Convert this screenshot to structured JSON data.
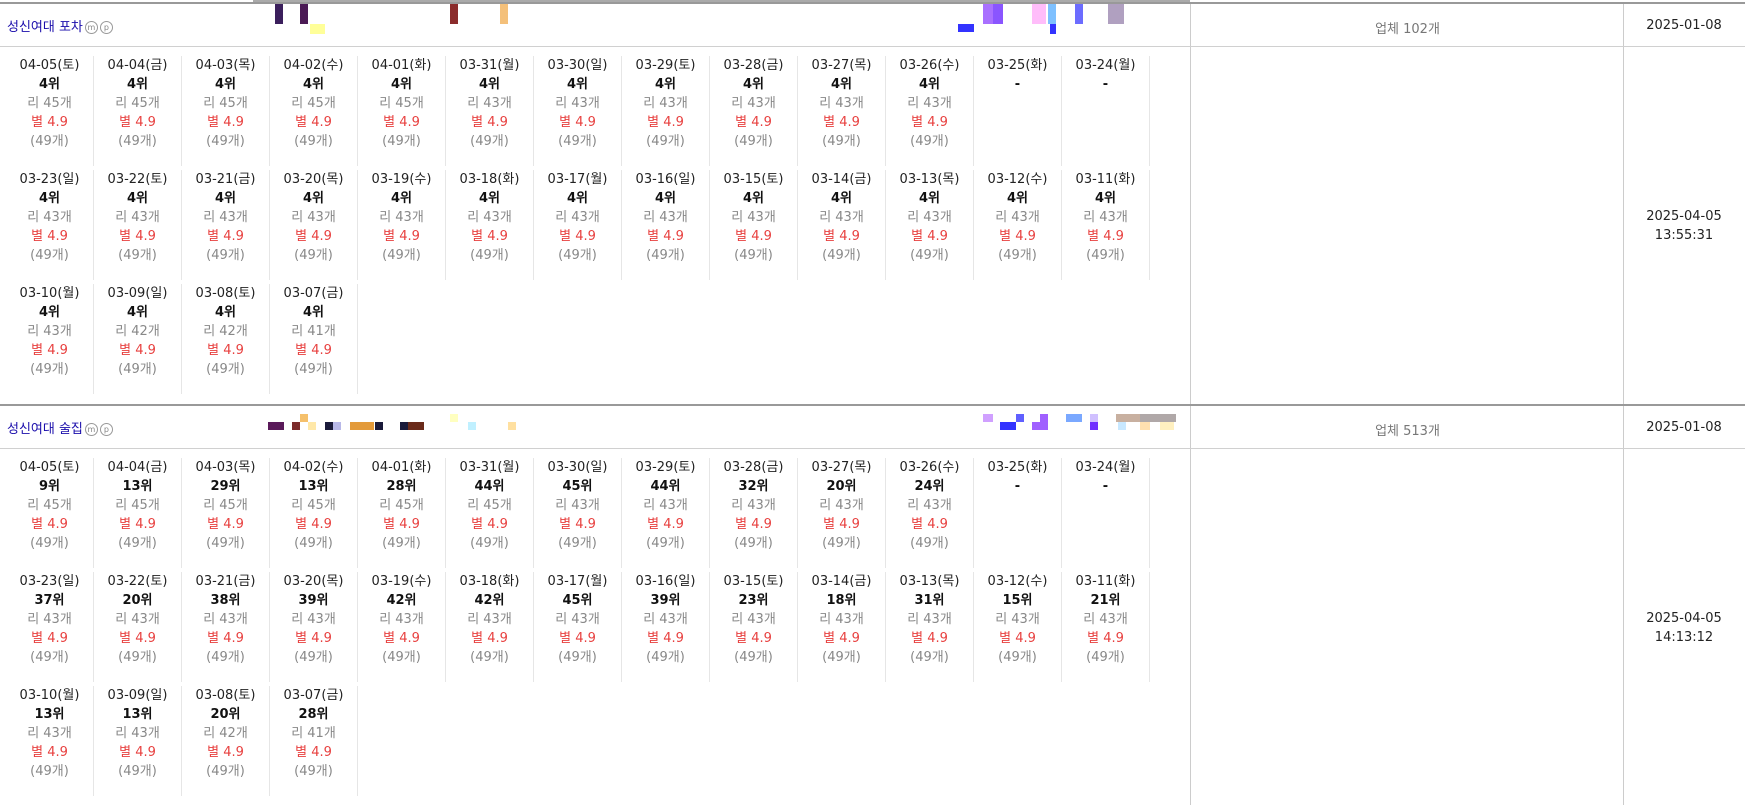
{
  "sections": [
    {
      "title": "성신여대 포차",
      "icons": [
        "m-circle-icon",
        "p-circle-icon"
      ],
      "icon_glyphs": [
        "m",
        "p"
      ],
      "count_label": "업체 102개",
      "start_date": "2025-01-08",
      "updated_date": "2025-04-05",
      "updated_time": "13:55:31",
      "rows": [
        [
          {
            "date": "04-05(토)",
            "rank": "4위",
            "reviews": "리 45개",
            "stars": "별 4.9",
            "count": "(49개)"
          },
          {
            "date": "04-04(금)",
            "rank": "4위",
            "reviews": "리 45개",
            "stars": "별 4.9",
            "count": "(49개)"
          },
          {
            "date": "04-03(목)",
            "rank": "4위",
            "reviews": "리 45개",
            "stars": "별 4.9",
            "count": "(49개)"
          },
          {
            "date": "04-02(수)",
            "rank": "4위",
            "reviews": "리 45개",
            "stars": "별 4.9",
            "count": "(49개)"
          },
          {
            "date": "04-01(화)",
            "rank": "4위",
            "reviews": "리 45개",
            "stars": "별 4.9",
            "count": "(49개)"
          },
          {
            "date": "03-31(월)",
            "rank": "4위",
            "reviews": "리 43개",
            "stars": "별 4.9",
            "count": "(49개)"
          },
          {
            "date": "03-30(일)",
            "rank": "4위",
            "reviews": "리 43개",
            "stars": "별 4.9",
            "count": "(49개)"
          },
          {
            "date": "03-29(토)",
            "rank": "4위",
            "reviews": "리 43개",
            "stars": "별 4.9",
            "count": "(49개)"
          },
          {
            "date": "03-28(금)",
            "rank": "4위",
            "reviews": "리 43개",
            "stars": "별 4.9",
            "count": "(49개)"
          },
          {
            "date": "03-27(목)",
            "rank": "4위",
            "reviews": "리 43개",
            "stars": "별 4.9",
            "count": "(49개)"
          },
          {
            "date": "03-26(수)",
            "rank": "4위",
            "reviews": "리 43개",
            "stars": "별 4.9",
            "count": "(49개)"
          },
          {
            "date": "03-25(화)",
            "rank": "-",
            "reviews": "",
            "stars": "",
            "count": ""
          },
          {
            "date": "03-24(월)",
            "rank": "-",
            "reviews": "",
            "stars": "",
            "count": ""
          }
        ],
        [
          {
            "date": "03-23(일)",
            "rank": "4위",
            "reviews": "리 43개",
            "stars": "별 4.9",
            "count": "(49개)"
          },
          {
            "date": "03-22(토)",
            "rank": "4위",
            "reviews": "리 43개",
            "stars": "별 4.9",
            "count": "(49개)"
          },
          {
            "date": "03-21(금)",
            "rank": "4위",
            "reviews": "리 43개",
            "stars": "별 4.9",
            "count": "(49개)"
          },
          {
            "date": "03-20(목)",
            "rank": "4위",
            "reviews": "리 43개",
            "stars": "별 4.9",
            "count": "(49개)"
          },
          {
            "date": "03-19(수)",
            "rank": "4위",
            "reviews": "리 43개",
            "stars": "별 4.9",
            "count": "(49개)"
          },
          {
            "date": "03-18(화)",
            "rank": "4위",
            "reviews": "리 43개",
            "stars": "별 4.9",
            "count": "(49개)"
          },
          {
            "date": "03-17(월)",
            "rank": "4위",
            "reviews": "리 43개",
            "stars": "별 4.9",
            "count": "(49개)"
          },
          {
            "date": "03-16(일)",
            "rank": "4위",
            "reviews": "리 43개",
            "stars": "별 4.9",
            "count": "(49개)"
          },
          {
            "date": "03-15(토)",
            "rank": "4위",
            "reviews": "리 43개",
            "stars": "별 4.9",
            "count": "(49개)"
          },
          {
            "date": "03-14(금)",
            "rank": "4위",
            "reviews": "리 43개",
            "stars": "별 4.9",
            "count": "(49개)"
          },
          {
            "date": "03-13(목)",
            "rank": "4위",
            "reviews": "리 43개",
            "stars": "별 4.9",
            "count": "(49개)"
          },
          {
            "date": "03-12(수)",
            "rank": "4위",
            "reviews": "리 43개",
            "stars": "별 4.9",
            "count": "(49개)"
          },
          {
            "date": "03-11(화)",
            "rank": "4위",
            "reviews": "리 43개",
            "stars": "별 4.9",
            "count": "(49개)"
          }
        ],
        [
          {
            "date": "03-10(월)",
            "rank": "4위",
            "reviews": "리 43개",
            "stars": "별 4.9",
            "count": "(49개)"
          },
          {
            "date": "03-09(일)",
            "rank": "4위",
            "reviews": "리 42개",
            "stars": "별 4.9",
            "count": "(49개)"
          },
          {
            "date": "03-08(토)",
            "rank": "4위",
            "reviews": "리 42개",
            "stars": "별 4.9",
            "count": "(49개)"
          },
          {
            "date": "03-07(금)",
            "rank": "4위",
            "reviews": "리 41개",
            "stars": "별 4.9",
            "count": "(49개)"
          }
        ]
      ]
    },
    {
      "title": "성신여대 술집",
      "icons": [
        "m-circle-icon",
        "p-circle-icon"
      ],
      "icon_glyphs": [
        "m",
        "p"
      ],
      "count_label": "업체 513개",
      "start_date": "2025-01-08",
      "updated_date": "2025-04-05",
      "updated_time": "14:13:12",
      "rows": [
        [
          {
            "date": "04-05(토)",
            "rank": "9위",
            "reviews": "리 45개",
            "stars": "별 4.9",
            "count": "(49개)"
          },
          {
            "date": "04-04(금)",
            "rank": "13위",
            "reviews": "리 45개",
            "stars": "별 4.9",
            "count": "(49개)"
          },
          {
            "date": "04-03(목)",
            "rank": "29위",
            "reviews": "리 45개",
            "stars": "별 4.9",
            "count": "(49개)"
          },
          {
            "date": "04-02(수)",
            "rank": "13위",
            "reviews": "리 45개",
            "stars": "별 4.9",
            "count": "(49개)"
          },
          {
            "date": "04-01(화)",
            "rank": "28위",
            "reviews": "리 45개",
            "stars": "별 4.9",
            "count": "(49개)"
          },
          {
            "date": "03-31(월)",
            "rank": "44위",
            "reviews": "리 45개",
            "stars": "별 4.9",
            "count": "(49개)"
          },
          {
            "date": "03-30(일)",
            "rank": "45위",
            "reviews": "리 43개",
            "stars": "별 4.9",
            "count": "(49개)"
          },
          {
            "date": "03-29(토)",
            "rank": "44위",
            "reviews": "리 43개",
            "stars": "별 4.9",
            "count": "(49개)"
          },
          {
            "date": "03-28(금)",
            "rank": "32위",
            "reviews": "리 43개",
            "stars": "별 4.9",
            "count": "(49개)"
          },
          {
            "date": "03-27(목)",
            "rank": "20위",
            "reviews": "리 43개",
            "stars": "별 4.9",
            "count": "(49개)"
          },
          {
            "date": "03-26(수)",
            "rank": "24위",
            "reviews": "리 43개",
            "stars": "별 4.9",
            "count": "(49개)"
          },
          {
            "date": "03-25(화)",
            "rank": "-",
            "reviews": "",
            "stars": "",
            "count": ""
          },
          {
            "date": "03-24(월)",
            "rank": "-",
            "reviews": "",
            "stars": "",
            "count": ""
          }
        ],
        [
          {
            "date": "03-23(일)",
            "rank": "37위",
            "reviews": "리 43개",
            "stars": "별 4.9",
            "count": "(49개)"
          },
          {
            "date": "03-22(토)",
            "rank": "20위",
            "reviews": "리 43개",
            "stars": "별 4.9",
            "count": "(49개)"
          },
          {
            "date": "03-21(금)",
            "rank": "38위",
            "reviews": "리 43개",
            "stars": "별 4.9",
            "count": "(49개)"
          },
          {
            "date": "03-20(목)",
            "rank": "39위",
            "reviews": "리 43개",
            "stars": "별 4.9",
            "count": "(49개)"
          },
          {
            "date": "03-19(수)",
            "rank": "42위",
            "reviews": "리 43개",
            "stars": "별 4.9",
            "count": "(49개)"
          },
          {
            "date": "03-18(화)",
            "rank": "42위",
            "reviews": "리 43개",
            "stars": "별 4.9",
            "count": "(49개)"
          },
          {
            "date": "03-17(월)",
            "rank": "45위",
            "reviews": "리 43개",
            "stars": "별 4.9",
            "count": "(49개)"
          },
          {
            "date": "03-16(일)",
            "rank": "39위",
            "reviews": "리 43개",
            "stars": "별 4.9",
            "count": "(49개)"
          },
          {
            "date": "03-15(토)",
            "rank": "23위",
            "reviews": "리 43개",
            "stars": "별 4.9",
            "count": "(49개)"
          },
          {
            "date": "03-14(금)",
            "rank": "18위",
            "reviews": "리 43개",
            "stars": "별 4.9",
            "count": "(49개)"
          },
          {
            "date": "03-13(목)",
            "rank": "31위",
            "reviews": "리 43개",
            "stars": "별 4.9",
            "count": "(49개)"
          },
          {
            "date": "03-12(수)",
            "rank": "15위",
            "reviews": "리 43개",
            "stars": "별 4.9",
            "count": "(49개)"
          },
          {
            "date": "03-11(화)",
            "rank": "21위",
            "reviews": "리 43개",
            "stars": "별 4.9",
            "count": "(49개)"
          }
        ],
        [
          {
            "date": "03-10(월)",
            "rank": "13위",
            "reviews": "리 43개",
            "stars": "별 4.9",
            "count": "(49개)"
          },
          {
            "date": "03-09(일)",
            "rank": "13위",
            "reviews": "리 43개",
            "stars": "별 4.9",
            "count": "(49개)"
          },
          {
            "date": "03-08(토)",
            "rank": "20위",
            "reviews": "리 42개",
            "stars": "별 4.9",
            "count": "(49개)"
          },
          {
            "date": "03-07(금)",
            "rank": "28위",
            "reviews": "리 41개",
            "stars": "별 4.9",
            "count": "(49개)"
          }
        ]
      ]
    }
  ],
  "colors": {
    "title_link": "#1a0dab",
    "rank": "#111111",
    "reviews": "#888888",
    "stars": "#e8403f",
    "count": "#888888",
    "border": "#cccccc"
  }
}
